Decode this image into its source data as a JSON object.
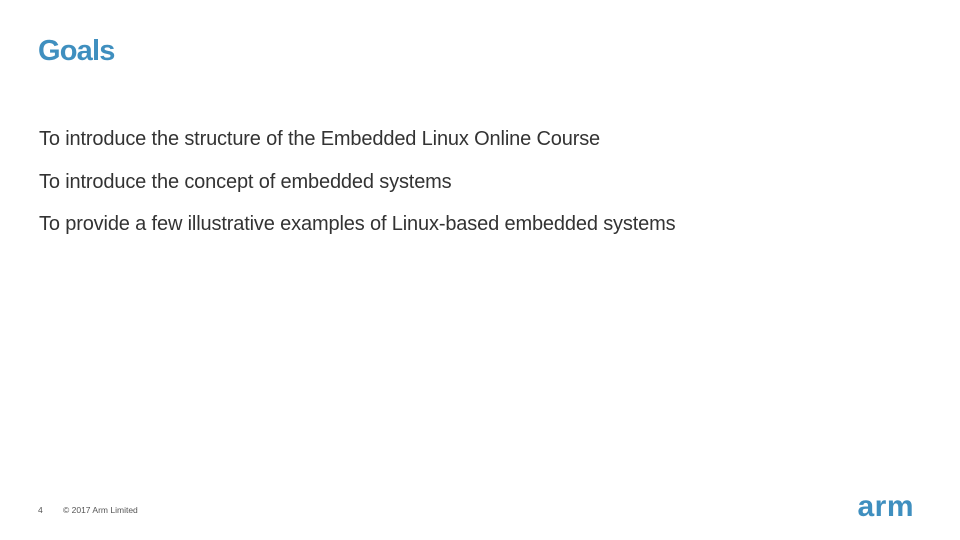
{
  "slide": {
    "title": "Goals",
    "bullets": [
      "To introduce the structure of the Embedded Linux Online Course",
      "To introduce the concept of embedded systems",
      "To provide a few illustrative examples of Linux-based embedded systems"
    ]
  },
  "footer": {
    "page_number": "4",
    "copyright": "© 2017 Arm Limited"
  },
  "logo": {
    "text": "arm"
  },
  "colors": {
    "accent": "#3f8fbf",
    "body_text": "#333333",
    "background": "#ffffff"
  }
}
